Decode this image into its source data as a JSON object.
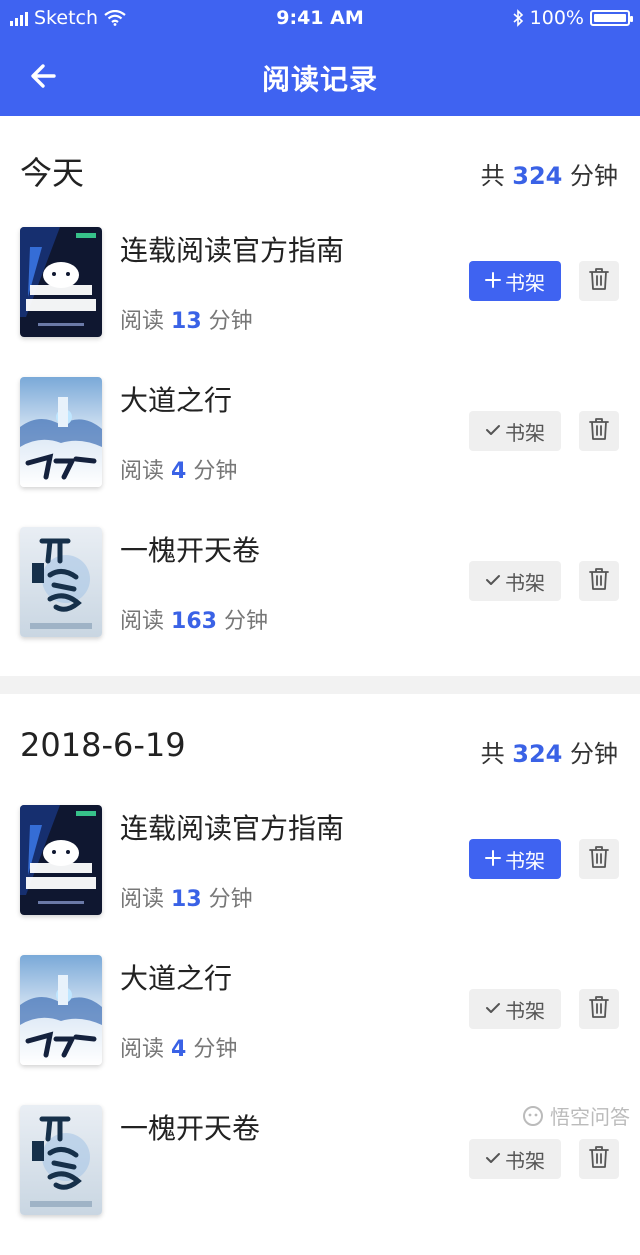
{
  "status_bar": {
    "carrier": "Sketch",
    "time": "9:41 AM",
    "battery": "100%"
  },
  "navbar": {
    "title": "阅读记录"
  },
  "colors": {
    "accent": "#3f63f1",
    "highlight": "#3a62e6"
  },
  "labels": {
    "total_prefix": "共",
    "minutes": "分钟",
    "read_prefix": "阅读",
    "shelf": "书架"
  },
  "sections": [
    {
      "date": "今天",
      "total": "324",
      "books": [
        {
          "title": "连载阅读官方指南",
          "minutes": "13",
          "in_shelf": false,
          "cover": "guide"
        },
        {
          "title": "大道之行",
          "minutes": "4",
          "in_shelf": true,
          "cover": "dadao"
        },
        {
          "title": "一槐开天卷",
          "minutes": "163",
          "in_shelf": true,
          "cover": "kaitian"
        }
      ]
    },
    {
      "date": "2018-6-19",
      "total": "324",
      "books": [
        {
          "title": "连载阅读官方指南",
          "minutes": "13",
          "in_shelf": false,
          "cover": "guide"
        },
        {
          "title": "大道之行",
          "minutes": "4",
          "in_shelf": true,
          "cover": "dadao"
        },
        {
          "title": "一槐开天卷",
          "minutes": "",
          "in_shelf": true,
          "cover": "kaitian"
        }
      ]
    }
  ],
  "watermark": "悟空问答"
}
